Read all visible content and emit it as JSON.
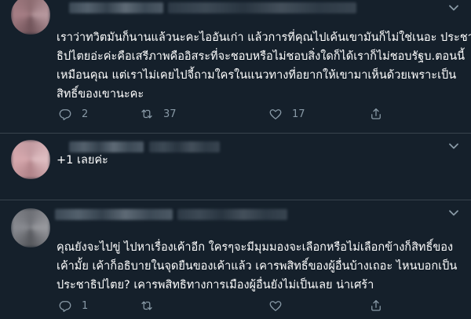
{
  "tweets": [
    {
      "lines": [
        "เราว่าทวิตมันก็นานแล้วนะคะไออันเก่า แล้วการที่คุณไปเค้นเขามันก็ไม่ใช่เนอะ ประชา",
        "ธิปไตยอ่ะค่ะคือเสรีภาพคืออิสระที่จะชอบหรือไม่ชอบสิ่งใดก็ได้เราก็ไม่ชอบรัฐบ.ตอนนี้",
        "เหมือนคุณ แต่เราไม่เคยไปจี้ถามใครในแนวทางที่อยากให้เขามาเห็นด้วยเพราะเป็น",
        "สิทธิ์ของเขานะคะ"
      ],
      "reply_count": "2",
      "retweet_count": "37",
      "like_count": "17"
    },
    {
      "lines": [
        "+1 เลยค่ะ"
      ]
    },
    {
      "lines": [
        "คุณยังจะไปขู่ ไปหาเรื่องเค้าอีก ใครๆจะมีมุมมองจะเลือกหรือไม่เลือกข้างก็สิทธิ์ของ",
        "เค้ามั้ย เค้าก็อธิบายในจุดยืนของเค้าแล้ว เคารพสิทธิ์ของผู้อื่นบ้างเถอะ ไหนบอกเป็น",
        "ประชาธิปไตย? เคารพสิทธิทางการเมืองผู้อื่นยังไม่เป็นเลย น่าเศร้า"
      ],
      "reply_count": "1"
    }
  ],
  "colors": {
    "background": "#15202b",
    "text": "#ffffff",
    "muted": "#8899a6",
    "divider": "#38444d"
  },
  "icons": [
    "reply-icon",
    "retweet-icon",
    "like-icon",
    "share-icon",
    "caret-down-icon"
  ]
}
